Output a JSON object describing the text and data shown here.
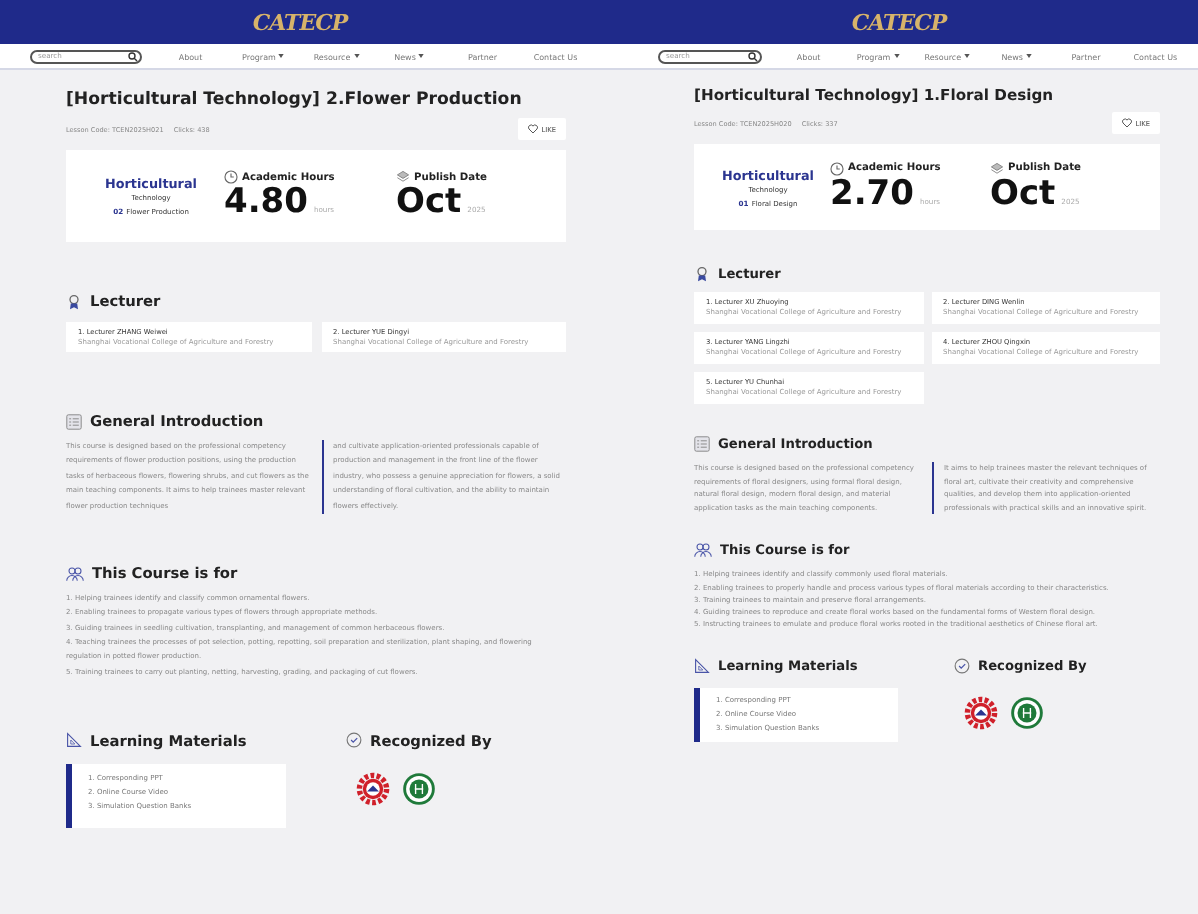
{
  "pages": [
    {
      "logo": "CATECP",
      "search": {
        "placeholder": "search"
      },
      "nav": [
        {
          "label": "About",
          "has_menu": false
        },
        {
          "label": "Program",
          "has_menu": true
        },
        {
          "label": "Resource",
          "has_menu": true
        },
        {
          "label": "News",
          "has_menu": true
        },
        {
          "label": "Partner",
          "has_menu": false
        },
        {
          "label": "Contact Us",
          "has_menu": false
        }
      ],
      "title": "[Horticultural Technology] 2.Flower Production",
      "lesson_code": "Lesson Code: TCEN2025H021",
      "clicks": "Clicks:  438",
      "like": "LIKE",
      "course_logo": {
        "name": "Horticultural",
        "sub": "Technology",
        "number": "02",
        "topic": "Flower Production"
      },
      "hours": {
        "label": "Academic Hours",
        "value": "4.80",
        "unit": "hours"
      },
      "publish": {
        "label": "Publish Date",
        "value": "Oct",
        "year": "2025"
      },
      "lecturer": {
        "heading": "Lecturer",
        "items": [
          {
            "name": "1. Lecturer ZHANG Weiwei",
            "org": "Shanghai Vocational College of Agriculture and Forestry"
          },
          {
            "name": "2. Lecturer YUE Dingyi",
            "org": "Shanghai Vocational College of Agriculture and Forestry"
          }
        ]
      },
      "intro": {
        "heading": "General Introduction",
        "columns": [
          "This course is designed based on the professional competency requirements of flower production positions, using the production tasks of herbaceous flowers, flowering shrubs, and cut flowers as the main teaching components. It aims to help trainees master relevant flower production techniques",
          "and cultivate application-oriented professionals capable of production and management in the front line of the flower industry, who possess a genuine appreciation for flowers, a solid understanding of floral cultivation, and the ability to maintain flowers effectively."
        ]
      },
      "audience": {
        "heading": "This Course is for",
        "items": [
          "1. Helping trainees identify and classify common ornamental flowers.",
          "2. Enabling trainees to propagate various types of flowers through appropriate methods.",
          "3. Guiding trainees in seedling cultivation, transplanting, and management of common herbaceous flowers.",
          "4. Teaching trainees the processes of pot selection, potting, repotting, soil preparation and sterilization, plant shaping, and flowering regulation in potted flower production.",
          "5. Training trainees to carry out planting, netting, harvesting, grading, and packaging of cut flowers."
        ]
      },
      "materials": {
        "heading": "Learning Materials",
        "items": [
          "1. Corresponding PPT",
          "2. Online Course Video",
          "3. Simulation Question Banks"
        ]
      },
      "recognized": {
        "heading": "Recognized By"
      }
    },
    {
      "logo": "CATECP",
      "search": {
        "placeholder": "search"
      },
      "nav": [
        {
          "label": "About",
          "has_menu": false
        },
        {
          "label": "Program",
          "has_menu": true
        },
        {
          "label": "Resource",
          "has_menu": true
        },
        {
          "label": "News",
          "has_menu": true
        },
        {
          "label": "Partner",
          "has_menu": false
        },
        {
          "label": "Contact Us",
          "has_menu": false
        }
      ],
      "title": "[Horticultural Technology] 1.Floral Design",
      "lesson_code": "Lesson Code: TCEN2025H020",
      "clicks": "Clicks:  337",
      "like": "LIKE",
      "course_logo": {
        "name": "Horticultural",
        "sub": "Technology",
        "number": "01",
        "topic": "Floral Design"
      },
      "hours": {
        "label": "Academic Hours",
        "value": "2.70",
        "unit": "hours"
      },
      "publish": {
        "label": "Publish Date",
        "value": "Oct",
        "year": "2025"
      },
      "lecturer": {
        "heading": "Lecturer",
        "items": [
          {
            "name": "1. Lecturer XU Zhuoying",
            "org": "Shanghai Vocational College of Agriculture and Forestry"
          },
          {
            "name": "2. Lecturer DING Wenlin",
            "org": "Shanghai Vocational College of Agriculture and Forestry"
          },
          {
            "name": "3. Lecturer YANG Lingzhi",
            "org": "Shanghai Vocational College of Agriculture and Forestry"
          },
          {
            "name": "4. Lecturer ZHOU Qingxin",
            "org": "Shanghai Vocational College of Agriculture and Forestry"
          },
          {
            "name": "5. Lecturer YU Chunhai",
            "org": "Shanghai Vocational College of Agriculture and Forestry"
          }
        ]
      },
      "intro": {
        "heading": "General Introduction",
        "columns": [
          "This course is designed based on the professional competency requirements of floral designers, using formal floral design, natural floral design, modern floral design, and material application tasks as the main teaching components.",
          "It aims to help trainees master the relevant techniques of floral art, cultivate their creativity and comprehensive qualities, and develop them into application-oriented professionals with practical skills and an innovative spirit."
        ]
      },
      "audience": {
        "heading": "This Course is for",
        "items": [
          "1. Helping trainees identify and classify commonly used floral materials.",
          "2. Enabling trainees to properly handle and process various types of floral materials according to their characteristics.",
          "3. Training trainees to maintain and preserve floral arrangements.",
          "4. Guiding trainees to reproduce and create floral works based on the fundamental forms of Western floral design.",
          "5. Instructing trainees to emulate and produce floral works rooted in the traditional aesthetics of Chinese floral art."
        ]
      },
      "materials": {
        "heading": "Learning Materials",
        "items": [
          "1. Corresponding PPT",
          "2. Online Course Video",
          "3. Simulation Question Banks"
        ]
      },
      "recognized": {
        "heading": "Recognized By"
      }
    }
  ]
}
